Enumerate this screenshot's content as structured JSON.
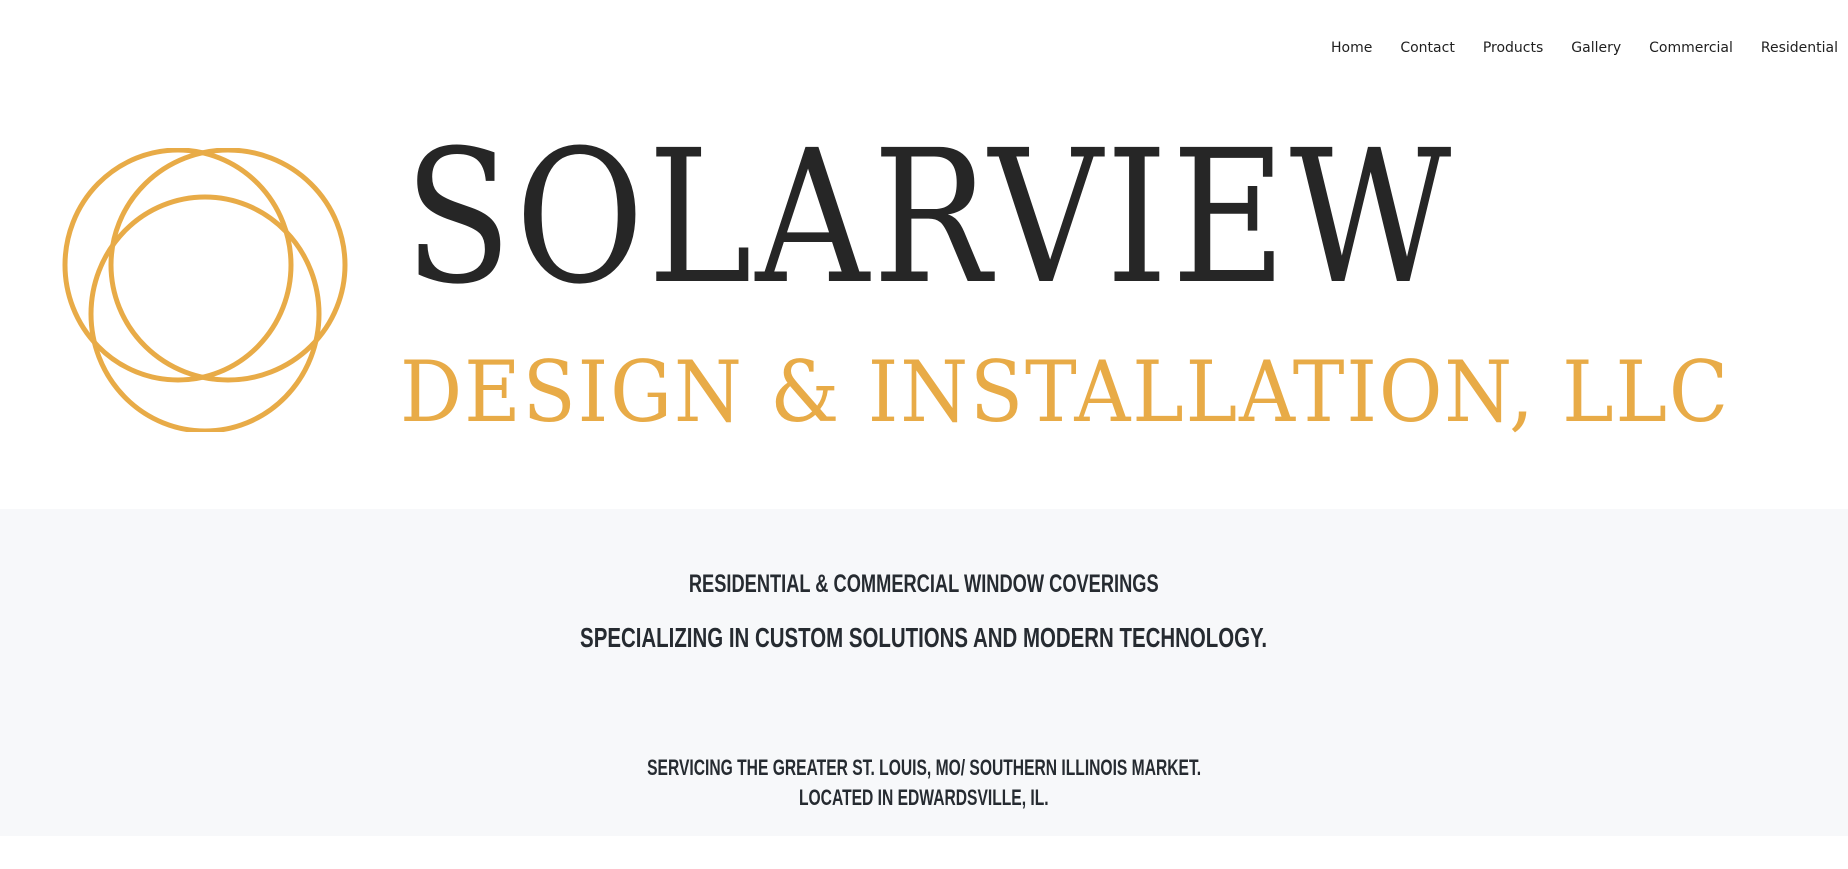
{
  "nav": {
    "items": [
      {
        "label": "Home"
      },
      {
        "label": "Contact"
      },
      {
        "label": "Products"
      },
      {
        "label": "Gallery"
      },
      {
        "label": "Commercial"
      },
      {
        "label": "Residential"
      }
    ]
  },
  "brand": {
    "name": "SOLARVIEW",
    "subtitle": "DESIGN & INSTALLATION, LLC",
    "logo_icon": "interlocking-circles-icon",
    "colors": {
      "gold": "#e8ab47",
      "dark": "#262626",
      "band_background": "#f7f8fa"
    }
  },
  "info": {
    "tagline_1": "Residential & Commercial Window Coverings",
    "tagline_2": "Specializing in Custom Solutions and Modern Technology.",
    "service_area": "Servicing the Greater St. Louis, MO/ Southern Illinois Market.",
    "location": "Located in Edwardsville, IL."
  }
}
